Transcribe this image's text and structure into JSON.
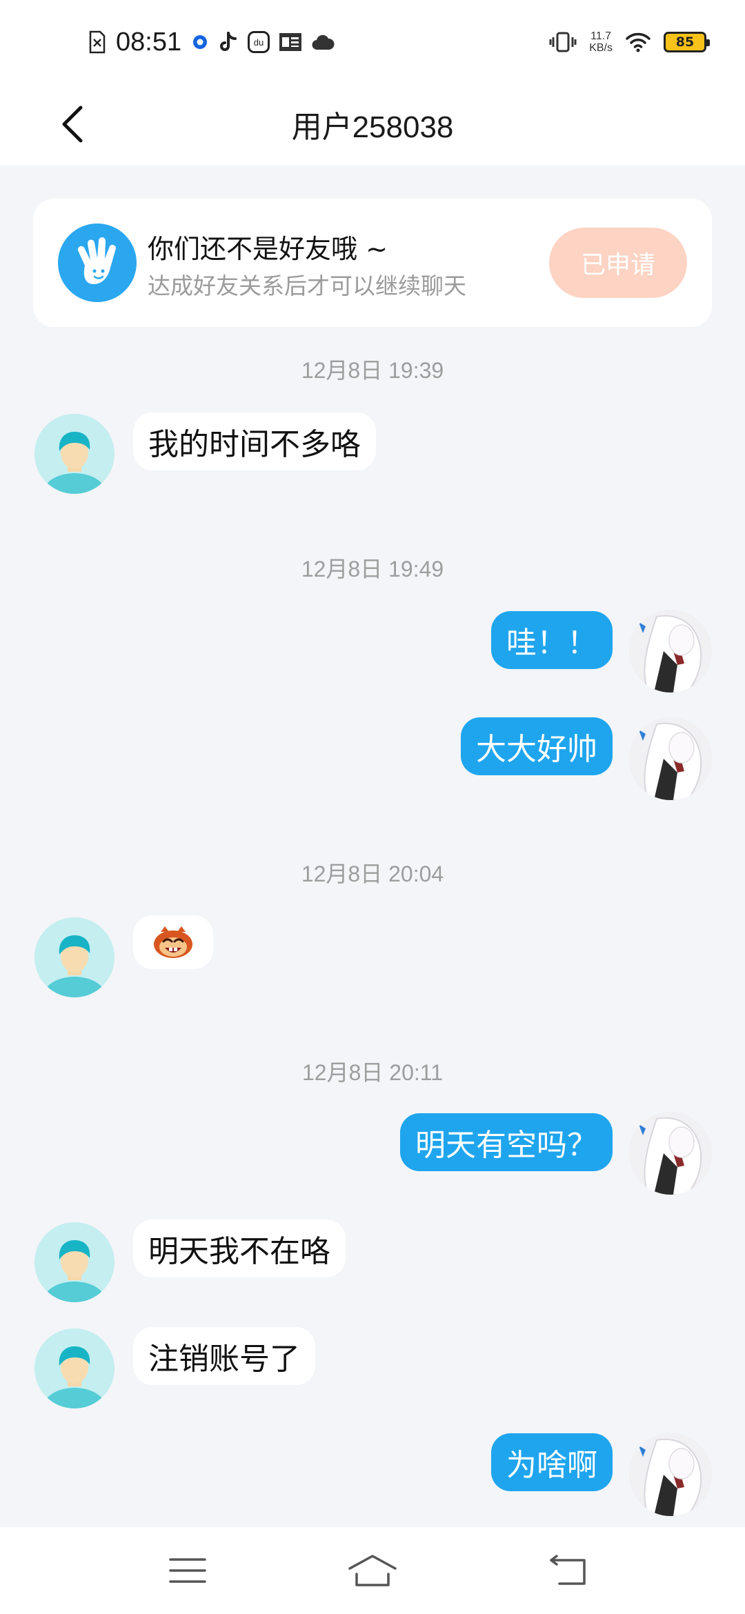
{
  "status_bar": {
    "time": "08:51",
    "net_speed_value": "11.7",
    "net_speed_unit": "KB/s",
    "battery": "85",
    "icons": [
      "sim-card-icon",
      "blue-ring-icon",
      "tiktok-icon",
      "du-app-icon",
      "toutiao-icon",
      "cloud-icon",
      "vibrate-icon",
      "wifi-icon",
      "battery-icon"
    ]
  },
  "header": {
    "title": "用户258038",
    "back_icon": "chevron-left-icon"
  },
  "notice": {
    "title": "你们还不是好友哦 ~",
    "subtitle": "达成好友关系后才可以继续聊天",
    "button_label": "已申请",
    "icon": "waving-hand-icon"
  },
  "messages": [
    {
      "type": "timestamp",
      "text": "12月8日 19:39"
    },
    {
      "type": "text",
      "side": "left",
      "text": "我的时间不多咯"
    },
    {
      "type": "timestamp",
      "text": "12月8日 19:49"
    },
    {
      "type": "text",
      "side": "right",
      "text": "哇！！"
    },
    {
      "type": "text",
      "side": "right",
      "text": "大大好帅"
    },
    {
      "type": "timestamp",
      "text": "12月8日 20:04"
    },
    {
      "type": "sticker",
      "side": "left",
      "icon": "monkey-emoji-icon"
    },
    {
      "type": "timestamp",
      "text": "12月8日 20:11"
    },
    {
      "type": "text",
      "side": "right",
      "text": "明天有空吗？"
    },
    {
      "type": "text",
      "side": "left",
      "text": "明天我不在咯"
    },
    {
      "type": "text",
      "side": "left",
      "text": "注销账号了"
    },
    {
      "type": "text",
      "side": "right",
      "text": "为啥啊"
    }
  ],
  "nav_bar": {
    "icons": [
      "menu-icon",
      "home-icon",
      "back-icon"
    ]
  },
  "colors": {
    "accent_blue": "#1fa5ee",
    "background": "#f3f5f8",
    "applied_button": "#fdd3c3",
    "battery_fill": "#f7c21a"
  }
}
